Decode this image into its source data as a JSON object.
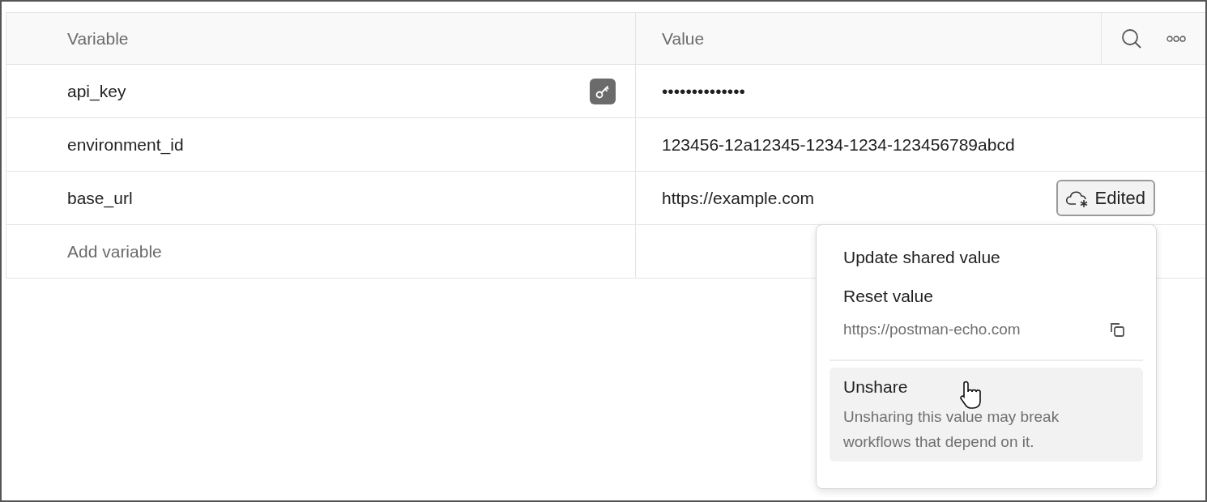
{
  "table": {
    "columns": [
      "Variable",
      "Value"
    ],
    "rows": [
      {
        "variable": "api_key",
        "value": "••••••••••••••",
        "secret": true
      },
      {
        "variable": "environment_id",
        "value": "123456-12a12345-1234-1234-123456789abcd",
        "secret": false
      },
      {
        "variable": "base_url",
        "value": "https://example.com",
        "secret": false,
        "badge": "Edited"
      }
    ],
    "add_placeholder": "Add variable"
  },
  "menu": {
    "items": [
      {
        "kind": "action",
        "label": "Update shared value",
        "hovered": false
      },
      {
        "kind": "action",
        "label": "Reset value",
        "detail": "https://postman-echo.com",
        "hovered": false
      },
      {
        "kind": "described",
        "label": "Unshare",
        "description": "Unsharing this value may break workflows that depend on it.",
        "hovered": true
      }
    ]
  }
}
